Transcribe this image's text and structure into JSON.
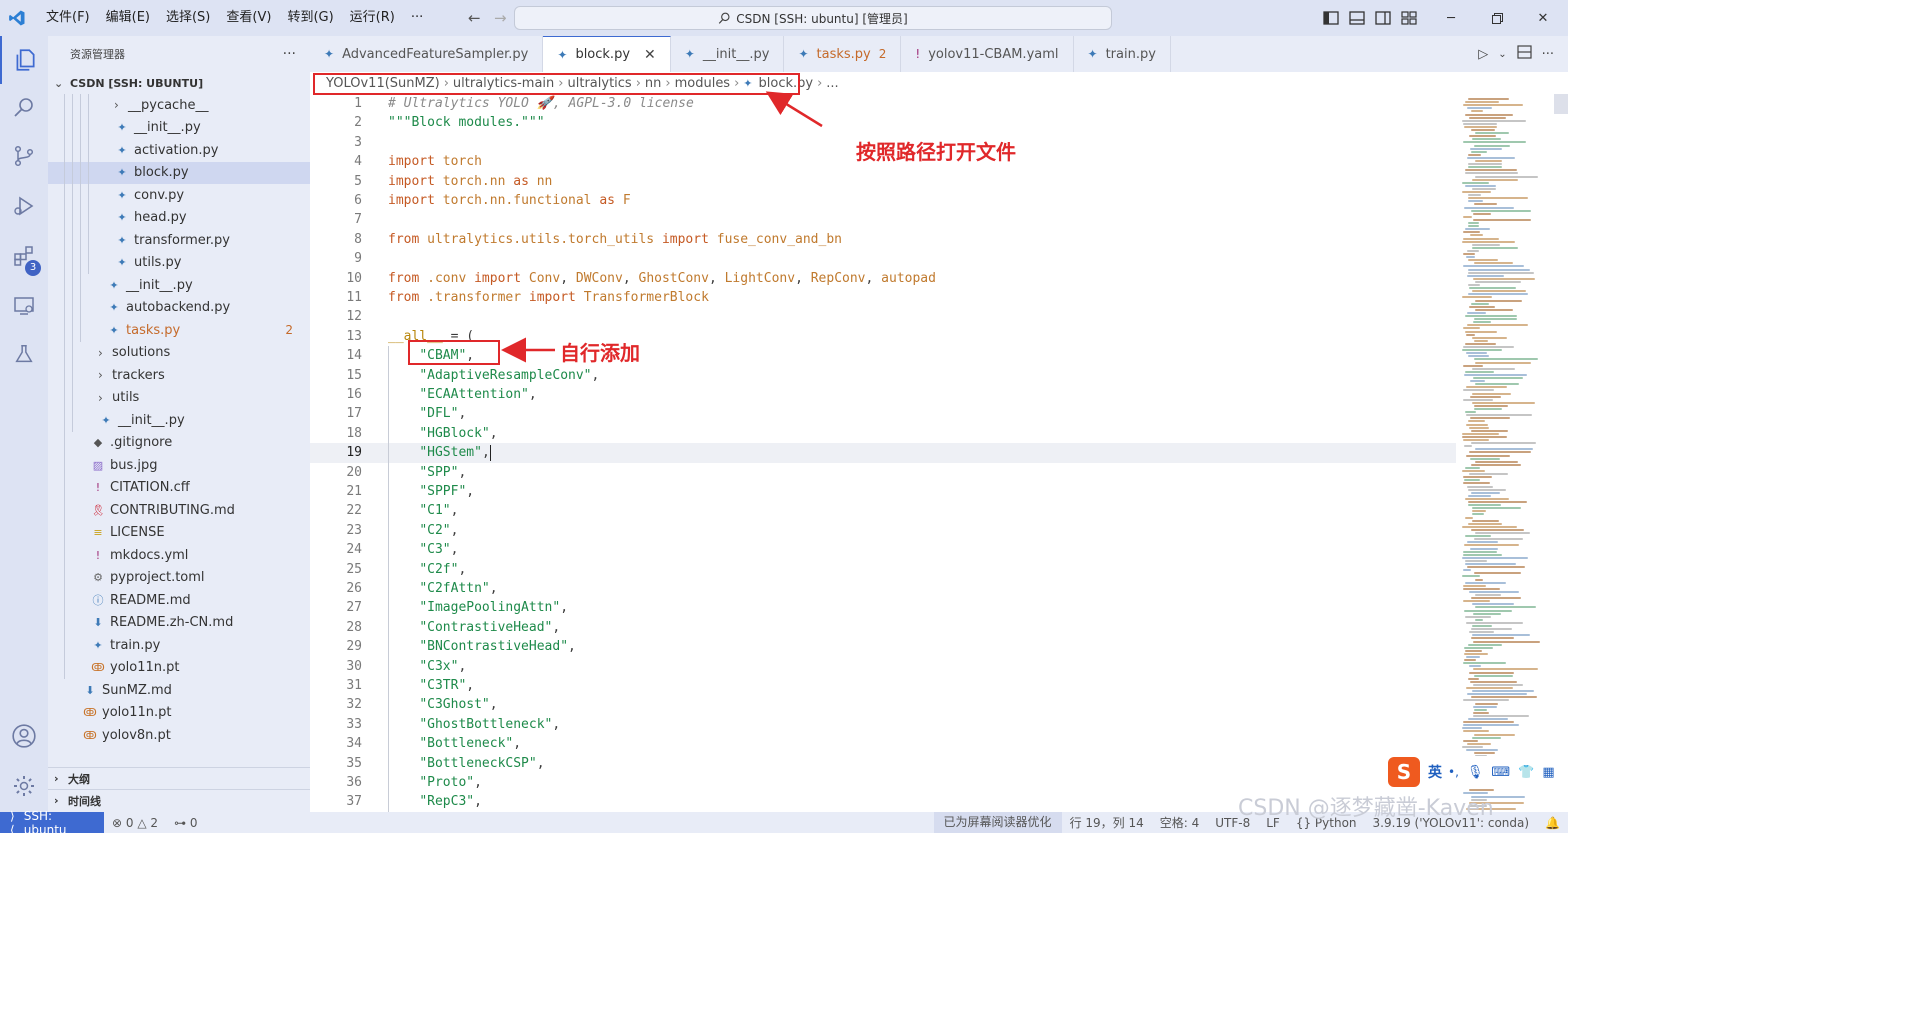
{
  "titlebar": {
    "menus": [
      "文件(F)",
      "编辑(E)",
      "选择(S)",
      "查看(V)",
      "转到(G)",
      "运行(R)",
      "···"
    ],
    "search_text": "CSDN [SSH: ubuntu] [管理员]"
  },
  "activity_bar": {
    "items": [
      "explorer-icon",
      "search-icon",
      "source-control-icon",
      "run-debug-icon",
      "extensions-icon",
      "remote-explorer-icon",
      "testing-icon"
    ],
    "extensions_badge": "3",
    "bottom": [
      "account-icon",
      "settings-gear-icon"
    ]
  },
  "sidebar": {
    "title": "资源管理器",
    "more": "···",
    "root": "CSDN [SSH: UBUNTU]",
    "tree": [
      {
        "label": "__pycache__",
        "kind": "folder",
        "indent": 3
      },
      {
        "label": "__init__.py",
        "kind": "py",
        "indent": 3
      },
      {
        "label": "activation.py",
        "kind": "py",
        "indent": 3
      },
      {
        "label": "block.py",
        "kind": "py",
        "indent": 3,
        "selected": true
      },
      {
        "label": "conv.py",
        "kind": "py",
        "indent": 3
      },
      {
        "label": "head.py",
        "kind": "py",
        "indent": 3
      },
      {
        "label": "transformer.py",
        "kind": "py",
        "indent": 3
      },
      {
        "label": "utils.py",
        "kind": "py",
        "indent": 3
      },
      {
        "label": "__init__.py",
        "kind": "py",
        "indent": 2
      },
      {
        "label": "autobackend.py",
        "kind": "py",
        "indent": 2
      },
      {
        "label": "tasks.py",
        "kind": "py",
        "indent": 2,
        "modified": true,
        "count": "2"
      },
      {
        "label": "solutions",
        "kind": "folder",
        "indent": 1
      },
      {
        "label": "trackers",
        "kind": "folder",
        "indent": 1
      },
      {
        "label": "utils",
        "kind": "folder",
        "indent": 1
      },
      {
        "label": "__init__.py",
        "kind": "py",
        "indent": 1
      },
      {
        "label": ".gitignore",
        "kind": "git",
        "indent": 0
      },
      {
        "label": "bus.jpg",
        "kind": "img",
        "indent": 0
      },
      {
        "label": "CITATION.cff",
        "kind": "yaml",
        "indent": 0
      },
      {
        "label": "CONTRIBUTING.md",
        "kind": "ribbon",
        "indent": 0
      },
      {
        "label": "LICENSE",
        "kind": "license",
        "indent": 0
      },
      {
        "label": "mkdocs.yml",
        "kind": "yaml",
        "indent": 0
      },
      {
        "label": "pyproject.toml",
        "kind": "gear",
        "indent": 0
      },
      {
        "label": "README.md",
        "kind": "info",
        "indent": 0
      },
      {
        "label": "README.zh-CN.md",
        "kind": "down",
        "indent": 0
      },
      {
        "label": "train.py",
        "kind": "py",
        "indent": 0
      },
      {
        "label": "yolo11n.pt",
        "kind": "rss",
        "indent": 0
      },
      {
        "label": "SunMZ.md",
        "kind": "down",
        "indent": -1
      },
      {
        "label": "yolo11n.pt",
        "kind": "rss",
        "indent": -1
      },
      {
        "label": "yolov8n.pt",
        "kind": "rss",
        "indent": -1
      }
    ],
    "outline": "大纲",
    "timeline": "时间线"
  },
  "tabs": [
    {
      "label": "AdvancedFeatureSampler.py",
      "icon": "py"
    },
    {
      "label": "block.py",
      "icon": "py",
      "active": true
    },
    {
      "label": "__init__.py",
      "icon": "py"
    },
    {
      "label": "tasks.py",
      "icon": "py",
      "modified": true,
      "count": "2"
    },
    {
      "label": "yolov11-CBAM.yaml",
      "icon": "yaml"
    },
    {
      "label": "train.py",
      "icon": "py"
    }
  ],
  "breadcrumb": [
    "YOLOv11(SunMZ)",
    "ultralytics-main",
    "ultralytics",
    "nn",
    "modules",
    "block.py",
    "..."
  ],
  "editor": {
    "current_line": 19,
    "lines": [
      {
        "n": "1",
        "t": [
          [
            "cmt",
            "# Ultralytics YOLO 🚀, AGPL-3.0 license"
          ]
        ]
      },
      {
        "n": "2",
        "t": [
          [
            "str",
            "\"\"\"Block modules.\"\"\""
          ]
        ]
      },
      {
        "n": "3",
        "t": []
      },
      {
        "n": "4",
        "t": [
          [
            "kw",
            "import "
          ],
          [
            "mod",
            "torch"
          ]
        ]
      },
      {
        "n": "5",
        "t": [
          [
            "kw",
            "import "
          ],
          [
            "mod",
            "torch.nn "
          ],
          [
            "kw",
            "as "
          ],
          [
            "mod",
            "nn"
          ]
        ]
      },
      {
        "n": "6",
        "t": [
          [
            "kw",
            "import "
          ],
          [
            "mod",
            "torch.nn.functional "
          ],
          [
            "kw",
            "as "
          ],
          [
            "mod",
            "F"
          ]
        ]
      },
      {
        "n": "7",
        "t": []
      },
      {
        "n": "8",
        "t": [
          [
            "kw",
            "from "
          ],
          [
            "mod",
            "ultralytics.utils.torch_utils "
          ],
          [
            "kw",
            "import "
          ],
          [
            "mod",
            "fuse_conv_and_bn"
          ]
        ]
      },
      {
        "n": "9",
        "t": []
      },
      {
        "n": "10",
        "t": [
          [
            "kw",
            "from "
          ],
          [
            "mod",
            ".conv "
          ],
          [
            "kw",
            "import "
          ],
          [
            "mod",
            "Conv"
          ],
          [
            "",
            ", "
          ],
          [
            "mod",
            "DWConv"
          ],
          [
            "",
            ", "
          ],
          [
            "mod",
            "GhostConv"
          ],
          [
            "",
            ", "
          ],
          [
            "mod",
            "LightConv"
          ],
          [
            "",
            ", "
          ],
          [
            "mod",
            "RepConv"
          ],
          [
            "",
            ", "
          ],
          [
            "mod",
            "autopad"
          ]
        ]
      },
      {
        "n": "11",
        "t": [
          [
            "kw",
            "from "
          ],
          [
            "mod",
            ".transformer "
          ],
          [
            "kw",
            "import "
          ],
          [
            "mod",
            "TransformerBlock"
          ]
        ]
      },
      {
        "n": "12",
        "t": []
      },
      {
        "n": "13",
        "t": [
          [
            "dun",
            "__all__"
          ],
          [
            "",
            " = ("
          ]
        ]
      },
      {
        "n": "14",
        "t": [
          [
            "",
            "    "
          ],
          [
            "str",
            "\"CBAM\""
          ],
          [
            "",
            ","
          ]
        ]
      },
      {
        "n": "15",
        "t": [
          [
            "",
            "    "
          ],
          [
            "str",
            "\"AdaptiveResampleConv\""
          ],
          [
            "",
            ","
          ]
        ]
      },
      {
        "n": "16",
        "t": [
          [
            "",
            "    "
          ],
          [
            "str",
            "\"ECAAttention\""
          ],
          [
            "",
            ","
          ]
        ]
      },
      {
        "n": "17",
        "t": [
          [
            "",
            "    "
          ],
          [
            "str",
            "\"DFL\""
          ],
          [
            "",
            ","
          ]
        ]
      },
      {
        "n": "18",
        "t": [
          [
            "",
            "    "
          ],
          [
            "str",
            "\"HGBlock\""
          ],
          [
            "",
            ","
          ]
        ]
      },
      {
        "n": "19",
        "t": [
          [
            "",
            "    "
          ],
          [
            "str",
            "\"HGStem\""
          ],
          [
            "",
            ","
          ]
        ]
      },
      {
        "n": "20",
        "t": [
          [
            "",
            "    "
          ],
          [
            "str",
            "\"SPP\""
          ],
          [
            "",
            ","
          ]
        ]
      },
      {
        "n": "21",
        "t": [
          [
            "",
            "    "
          ],
          [
            "str",
            "\"SPPF\""
          ],
          [
            "",
            ","
          ]
        ]
      },
      {
        "n": "22",
        "t": [
          [
            "",
            "    "
          ],
          [
            "str",
            "\"C1\""
          ],
          [
            "",
            ","
          ]
        ]
      },
      {
        "n": "23",
        "t": [
          [
            "",
            "    "
          ],
          [
            "str",
            "\"C2\""
          ],
          [
            "",
            ","
          ]
        ]
      },
      {
        "n": "24",
        "t": [
          [
            "",
            "    "
          ],
          [
            "str",
            "\"C3\""
          ],
          [
            "",
            ","
          ]
        ]
      },
      {
        "n": "25",
        "t": [
          [
            "",
            "    "
          ],
          [
            "str",
            "\"C2f\""
          ],
          [
            "",
            ","
          ]
        ]
      },
      {
        "n": "26",
        "t": [
          [
            "",
            "    "
          ],
          [
            "str",
            "\"C2fAttn\""
          ],
          [
            "",
            ","
          ]
        ]
      },
      {
        "n": "27",
        "t": [
          [
            "",
            "    "
          ],
          [
            "str",
            "\"ImagePoolingAttn\""
          ],
          [
            "",
            ","
          ]
        ]
      },
      {
        "n": "28",
        "t": [
          [
            "",
            "    "
          ],
          [
            "str",
            "\"ContrastiveHead\""
          ],
          [
            "",
            ","
          ]
        ]
      },
      {
        "n": "29",
        "t": [
          [
            "",
            "    "
          ],
          [
            "str",
            "\"BNContrastiveHead\""
          ],
          [
            "",
            ","
          ]
        ]
      },
      {
        "n": "30",
        "t": [
          [
            "",
            "    "
          ],
          [
            "str",
            "\"C3x\""
          ],
          [
            "",
            ","
          ]
        ]
      },
      {
        "n": "31",
        "t": [
          [
            "",
            "    "
          ],
          [
            "str",
            "\"C3TR\""
          ],
          [
            "",
            ","
          ]
        ]
      },
      {
        "n": "32",
        "t": [
          [
            "",
            "    "
          ],
          [
            "str",
            "\"C3Ghost\""
          ],
          [
            "",
            ","
          ]
        ]
      },
      {
        "n": "33",
        "t": [
          [
            "",
            "    "
          ],
          [
            "str",
            "\"GhostBottleneck\""
          ],
          [
            "",
            ","
          ]
        ]
      },
      {
        "n": "34",
        "t": [
          [
            "",
            "    "
          ],
          [
            "str",
            "\"Bottleneck\""
          ],
          [
            "",
            ","
          ]
        ]
      },
      {
        "n": "35",
        "t": [
          [
            "",
            "    "
          ],
          [
            "str",
            "\"BottleneckCSP\""
          ],
          [
            "",
            ","
          ]
        ]
      },
      {
        "n": "36",
        "t": [
          [
            "",
            "    "
          ],
          [
            "str",
            "\"Proto\""
          ],
          [
            "",
            ","
          ]
        ]
      },
      {
        "n": "37",
        "t": [
          [
            "",
            "    "
          ],
          [
            "str",
            "\"RepC3\""
          ],
          [
            "",
            ","
          ]
        ]
      }
    ]
  },
  "annotations": {
    "path_note": "按照路径打开文件",
    "add_note": "自行添加",
    "color": "#e0282a"
  },
  "statusbar": {
    "remote": "SSH: ubuntu",
    "errors": "0",
    "warnings": "2",
    "ports": "0",
    "screen_reader": "已为屏幕阅读器优化",
    "position": "行 19，列 14",
    "spaces": "空格: 4",
    "encoding": "UTF-8",
    "eol": "LF",
    "language": "Python",
    "interpreter": "3.9.19 ('YOLOv11': conda)"
  },
  "ime": {
    "lang": "英",
    "punct": "•,"
  },
  "watermark": "CSDN @逐梦藏凿-Kaven"
}
